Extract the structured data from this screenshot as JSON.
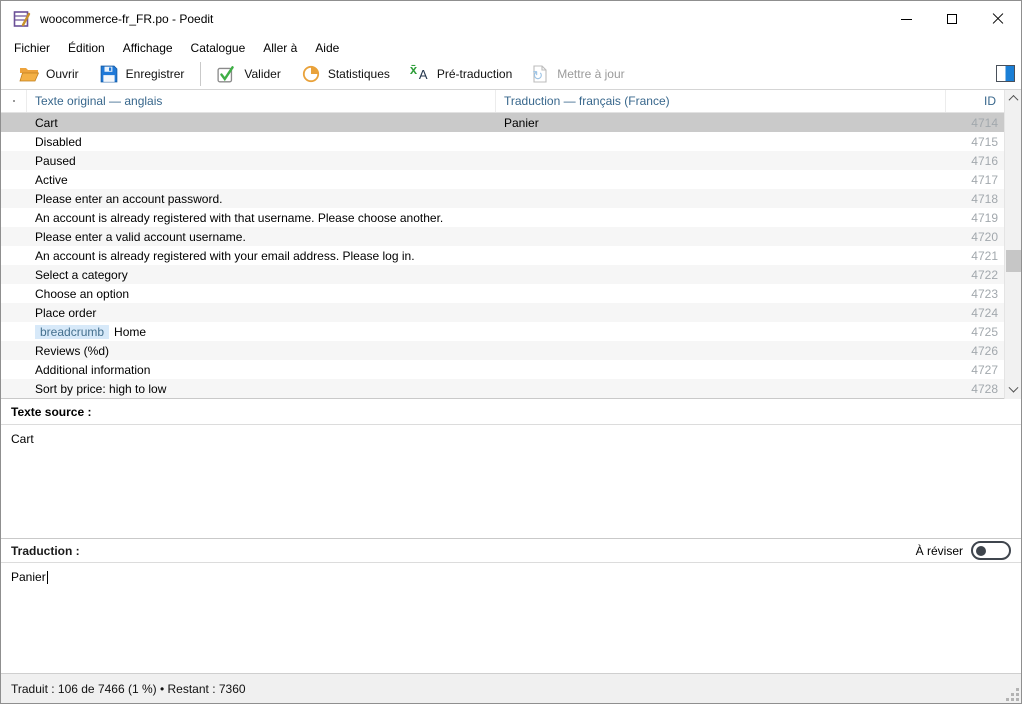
{
  "window": {
    "title": "woocommerce-fr_FR.po - Poedit",
    "app_icon": "poedit-app-icon",
    "controls": [
      "minimize",
      "maximize",
      "close"
    ]
  },
  "menu": {
    "items": [
      {
        "label": "Fichier"
      },
      {
        "label": "Édition"
      },
      {
        "label": "Affichage"
      },
      {
        "label": "Catalogue"
      },
      {
        "label": "Aller à"
      },
      {
        "label": "Aide"
      }
    ]
  },
  "toolbar": {
    "buttons": [
      {
        "label": "Ouvrir",
        "icon": "open-folder-icon",
        "enabled": true
      },
      {
        "label": "Enregistrer",
        "icon": "save-floppy-icon",
        "enabled": true
      },
      {
        "label": "Valider",
        "icon": "validate-check-icon",
        "enabled": true
      },
      {
        "label": "Statistiques",
        "icon": "pie-chart-icon",
        "enabled": true
      },
      {
        "label": "Pré-traduction",
        "icon": "pretranslate-icon",
        "enabled": true
      },
      {
        "label": "Mettre à jour",
        "icon": "update-refresh-icon",
        "enabled": false
      }
    ],
    "sidebar_toggle_icon": "sidebar-toggle-icon"
  },
  "grid": {
    "columns": {
      "source": "Texte original — anglais",
      "translation": "Traduction — français (France)",
      "id": "ID"
    },
    "rows": [
      {
        "source": "Cart",
        "translation": "Panier",
        "id": "4714",
        "selected": true
      },
      {
        "source": "Disabled",
        "translation": "",
        "id": "4715"
      },
      {
        "source": "Paused",
        "translation": "",
        "id": "4716"
      },
      {
        "source": "Active",
        "translation": "",
        "id": "4717"
      },
      {
        "source": "Please enter an account password.",
        "translation": "",
        "id": "4718"
      },
      {
        "source": "An account is already registered with that username. Please choose another.",
        "translation": "",
        "id": "4719"
      },
      {
        "source": "Please enter a valid account username.",
        "translation": "",
        "id": "4720"
      },
      {
        "source": "An account is already registered with your email address. Please log in.",
        "translation": "",
        "id": "4721"
      },
      {
        "source": "Select a category",
        "translation": "",
        "id": "4722"
      },
      {
        "source": "Choose an option",
        "translation": "",
        "id": "4723"
      },
      {
        "source": "Place order",
        "translation": "",
        "id": "4724"
      },
      {
        "source": "Home",
        "tag": "breadcrumb",
        "translation": "",
        "id": "4725"
      },
      {
        "source": "Reviews (%d)",
        "translation": "",
        "id": "4726"
      },
      {
        "source": "Additional information",
        "translation": "",
        "id": "4727"
      },
      {
        "source": "Sort by price: high to low",
        "translation": "",
        "id": "4728"
      }
    ]
  },
  "source_panel": {
    "label": "Texte source :",
    "text": "Cart"
  },
  "translation_panel": {
    "label": "Traduction :",
    "text": "Panier",
    "fuzzy_toggle_label": "À réviser",
    "fuzzy_on": false
  },
  "status_bar": {
    "text": "Traduit : 106 de 7466 (1 %)  •  Restant : 7360"
  },
  "colors": {
    "header_text": "#38678c",
    "selected_row_bg": "#cacaca",
    "stripe_row_bg": "#f6f6f6",
    "id_text": "#a2a8ad",
    "badge_bg": "#d7e9f9",
    "badge_text": "#44708e",
    "accent_blue": "#1b7fd6",
    "folder_orange": "#eda33c",
    "check_green": "#3faf46",
    "pie_orange": "#e9a23b",
    "disabled_text": "#9b9b9b"
  }
}
